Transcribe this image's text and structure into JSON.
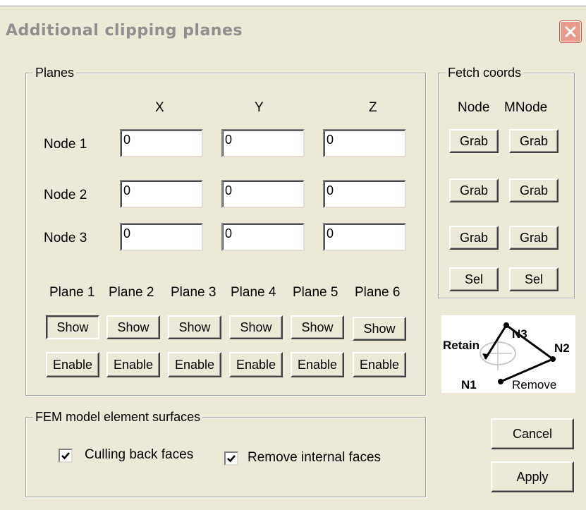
{
  "window": {
    "title": "Additional clipping planes"
  },
  "planes": {
    "legend": "Planes",
    "columns": [
      "X",
      "Y",
      "Z"
    ],
    "rows": [
      {
        "label": "Node 1",
        "values": [
          "0",
          "0",
          "0"
        ]
      },
      {
        "label": "Node 2",
        "values": [
          "0",
          "0",
          "0"
        ]
      },
      {
        "label": "Node 3",
        "values": [
          "0",
          "0",
          "0"
        ]
      }
    ],
    "plane_labels": [
      "Plane 1",
      "Plane 2",
      "Plane 3",
      "Plane 4",
      "Plane 5",
      "Plane 6"
    ],
    "show_label": "Show",
    "enable_label": "Enable"
  },
  "fetch": {
    "legend": "Fetch coords",
    "col_node": "Node",
    "col_mnode": "MNode",
    "grab_label": "Grab",
    "sel_label": "Sel"
  },
  "diagram": {
    "labels": {
      "retain": "Retain",
      "n3": "N3",
      "n2": "N2",
      "n1": "N1",
      "remove": "Remove"
    }
  },
  "fem": {
    "legend": "FEM model element surfaces",
    "culling_label": "Culling back faces",
    "culling_checked": true,
    "internal_label": "Remove internal faces",
    "internal_checked": true
  },
  "actions": {
    "cancel_label": "Cancel",
    "apply_label": "Apply"
  }
}
